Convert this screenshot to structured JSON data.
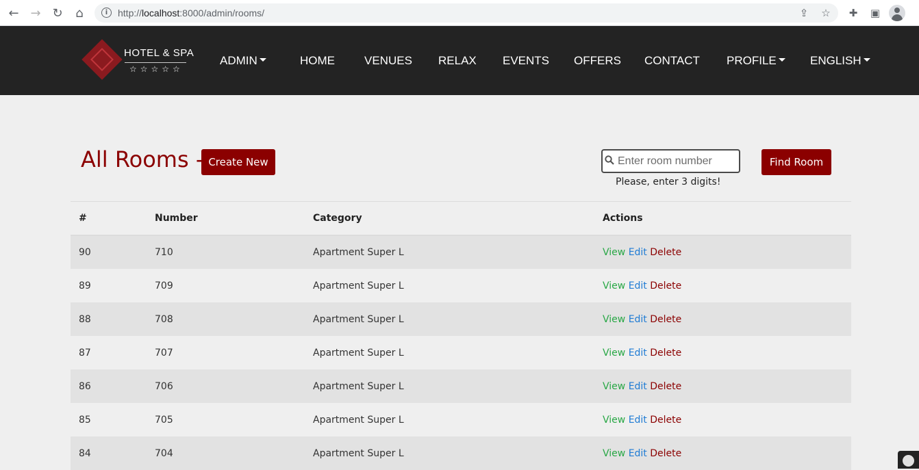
{
  "browser": {
    "url_prefix": "http://",
    "url_host": "localhost",
    "url_rest": ":8000/admin/rooms/"
  },
  "brand": {
    "name": "HOTEL & SPA",
    "stars": "☆☆☆☆☆",
    "color": "#8b1a1f"
  },
  "nav": {
    "items": [
      "ADMIN",
      "HOME",
      "VENUES",
      "RELAX",
      "EVENTS",
      "OFFERS",
      "CONTACT",
      "PROFILE",
      "ENGLISH"
    ]
  },
  "main": {
    "title": "All Rooms -",
    "create_button": "Create New",
    "search_placeholder": "Enter room number",
    "find_button": "Find Room",
    "hint": "Please, enter 3 digits!",
    "accent_color": "#8b0000"
  },
  "table": {
    "headers": [
      "#",
      "Number",
      "Category",
      "Actions"
    ],
    "rows": [
      {
        "id": "90",
        "number": "710",
        "category": "Apartment Super L"
      },
      {
        "id": "89",
        "number": "709",
        "category": "Apartment Super L"
      },
      {
        "id": "88",
        "number": "708",
        "category": "Apartment Super L"
      },
      {
        "id": "87",
        "number": "707",
        "category": "Apartment Super L"
      },
      {
        "id": "86",
        "number": "706",
        "category": "Apartment Super L"
      },
      {
        "id": "85",
        "number": "705",
        "category": "Apartment Super L"
      },
      {
        "id": "84",
        "number": "704",
        "category": "Apartment Super L"
      }
    ],
    "actions": {
      "view": "View",
      "edit": "Edit",
      "delete": "Delete"
    }
  }
}
